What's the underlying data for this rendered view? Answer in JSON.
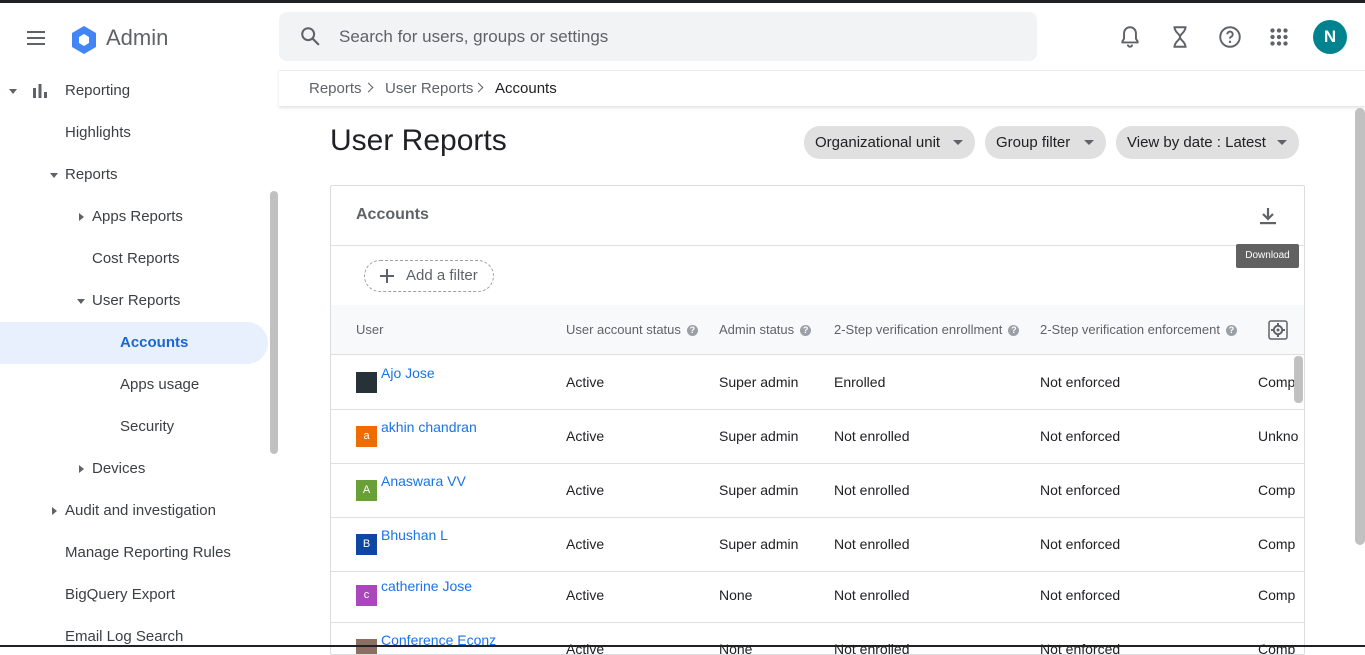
{
  "header": {
    "app_name": "Admin",
    "search_placeholder": "Search for users, groups or settings",
    "avatar_letter": "N",
    "colors": {
      "logo_blue": "#4285f4",
      "avatar": "#00838f"
    }
  },
  "sidebar": {
    "items": [
      {
        "label": "Reporting"
      },
      {
        "label": "Highlights"
      },
      {
        "label": "Reports"
      },
      {
        "label": "Apps Reports"
      },
      {
        "label": "Cost Reports"
      },
      {
        "label": "User Reports"
      },
      {
        "label": "Accounts"
      },
      {
        "label": "Apps usage"
      },
      {
        "label": "Security"
      },
      {
        "label": "Devices"
      },
      {
        "label": "Audit and investigation"
      },
      {
        "label": "Manage Reporting Rules"
      },
      {
        "label": "BigQuery Export"
      },
      {
        "label": "Email Log Search"
      }
    ]
  },
  "breadcrumb": [
    "Reports",
    "User Reports",
    "Accounts"
  ],
  "page": {
    "title": "User Reports",
    "chips": [
      "Organizational unit",
      "Group filter",
      "View by date : Latest"
    ]
  },
  "card": {
    "title": "Accounts",
    "add_filter": "Add a filter",
    "tooltip": "Download",
    "columns": [
      "User",
      "User account status",
      "Admin status",
      "2-Step verification enrollment",
      "2-Step verification enforcement"
    ],
    "rows": [
      {
        "letter": "",
        "color": "#263238",
        "name": "Ajo Jose",
        "status": "Active",
        "admin": "Super admin",
        "enroll": "Enrolled",
        "enforce": "Not enforced",
        "extra": "Comp"
      },
      {
        "letter": "a",
        "color": "#ef6c00",
        "name": "akhin chandran",
        "status": "Active",
        "admin": "Super admin",
        "enroll": "Not enrolled",
        "enforce": "Not enforced",
        "extra": "Unkno"
      },
      {
        "letter": "A",
        "color": "#689f38",
        "name": "Anaswara VV",
        "status": "Active",
        "admin": "Super admin",
        "enroll": "Not enrolled",
        "enforce": "Not enforced",
        "extra": "Comp"
      },
      {
        "letter": "B",
        "color": "#0d47a1",
        "name": "Bhushan L",
        "status": "Active",
        "admin": "Super admin",
        "enroll": "Not enrolled",
        "enforce": "Not enforced",
        "extra": "Comp"
      },
      {
        "letter": "c",
        "color": "#ab47bc",
        "name": "catherine Jose",
        "status": "Active",
        "admin": "None",
        "enroll": "Not enrolled",
        "enforce": "Not enforced",
        "extra": "Comp"
      },
      {
        "letter": "",
        "color": "#8d6e63",
        "name": "Conference Econz",
        "status": "Active",
        "admin": "None",
        "enroll": "Not enrolled",
        "enforce": "Not enforced",
        "extra": "Comp"
      }
    ]
  }
}
